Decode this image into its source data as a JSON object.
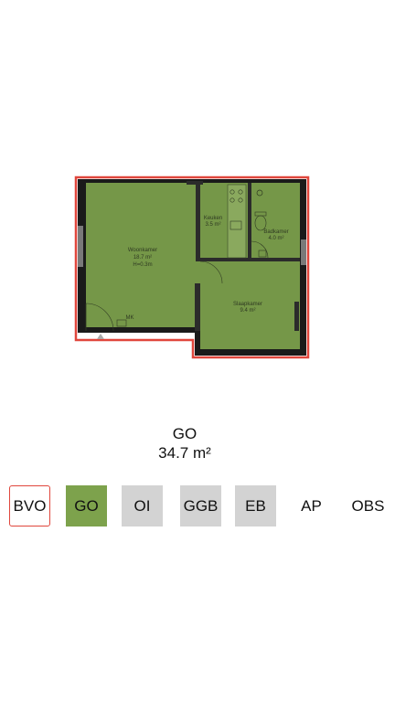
{
  "floorplan": {
    "rooms": [
      {
        "name": "Woonkamer",
        "area": "18.7 m²",
        "height": "H=0.3m"
      },
      {
        "name": "Keuken",
        "area": "3.5 m²"
      },
      {
        "name": "Badkamer",
        "area": "4.0 m²"
      },
      {
        "name": "Slaapkamer",
        "area": "9.4 m²"
      }
    ],
    "meter_label": "MK"
  },
  "selected_area": {
    "name": "GO",
    "value": "34.7 m²"
  },
  "tabs": [
    {
      "label": "BVO",
      "style": "outline"
    },
    {
      "label": "GO",
      "style": "filled"
    },
    {
      "label": "OI",
      "style": "grey"
    },
    {
      "label": "GGB",
      "style": "grey"
    },
    {
      "label": "EB",
      "style": "grey"
    },
    {
      "label": "AP",
      "style": "plain"
    },
    {
      "label": "OBS",
      "style": "plain"
    }
  ],
  "colors": {
    "outline": "#e0463c",
    "area_fill": "#7da24c",
    "tab_grey": "#d3d3d3",
    "wall": "#111111"
  }
}
